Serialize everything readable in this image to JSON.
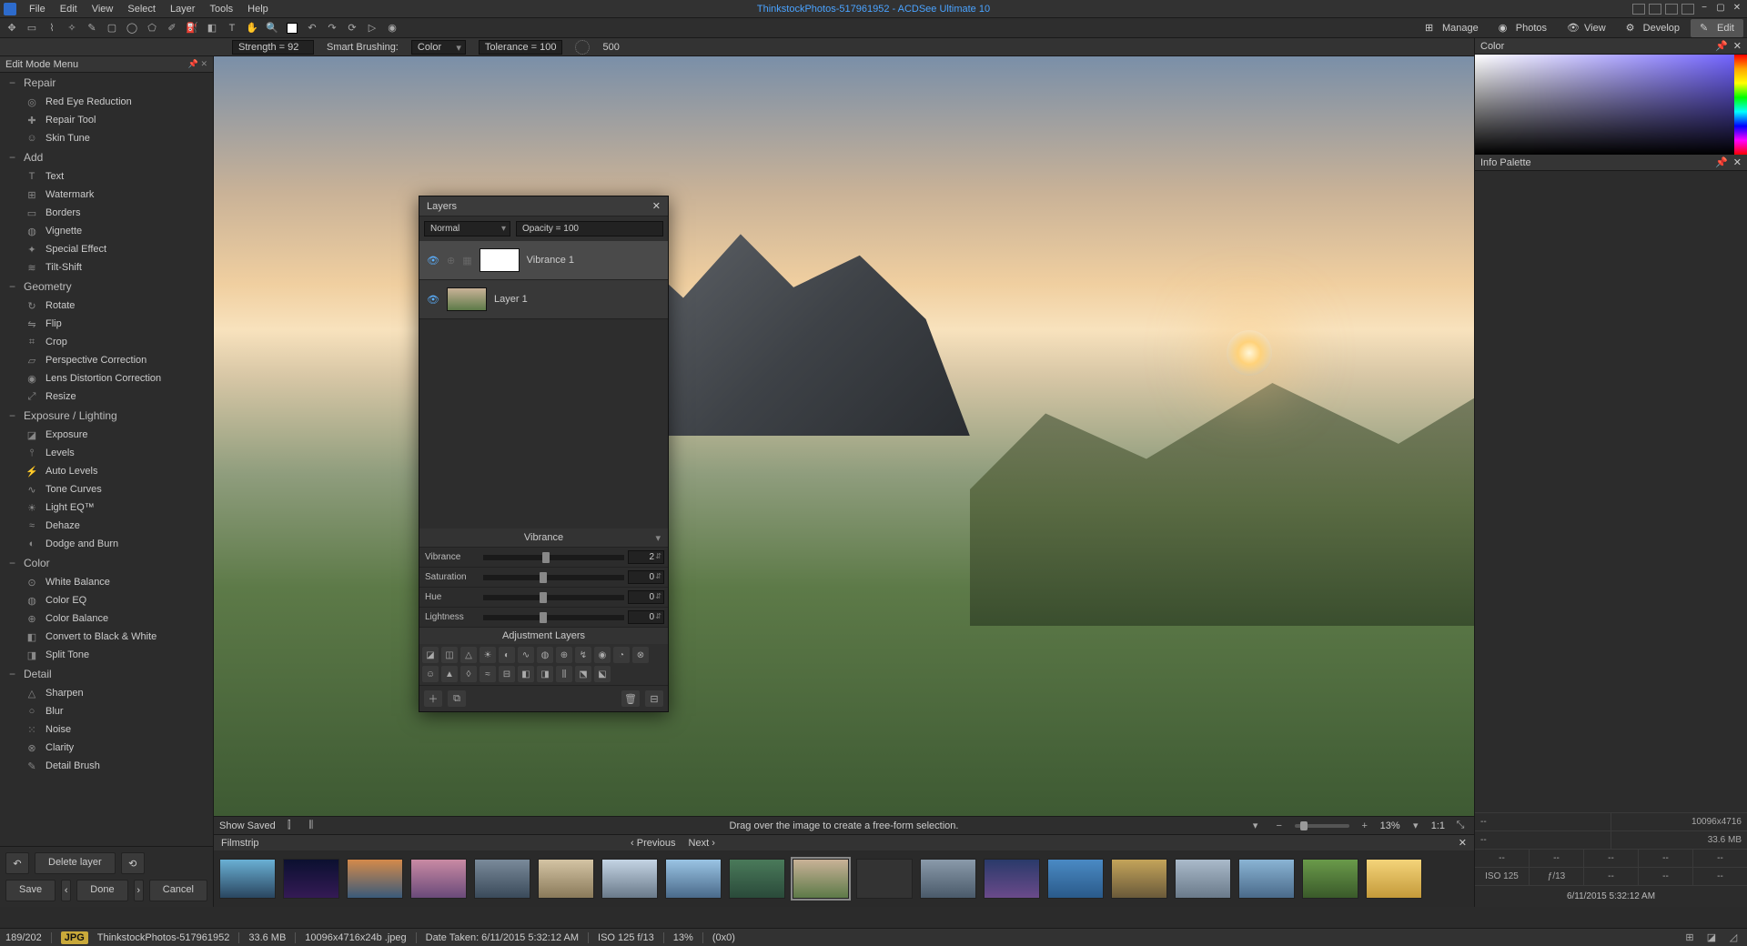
{
  "app": {
    "title": "ThinkstockPhotos-517961952 - ACDSee Ultimate 10"
  },
  "menu": [
    "File",
    "Edit",
    "View",
    "Select",
    "Layer",
    "Tools",
    "Help"
  ],
  "modes": [
    {
      "label": "Manage",
      "active": false
    },
    {
      "label": "Photos",
      "active": false
    },
    {
      "label": "View",
      "active": false
    },
    {
      "label": "Develop",
      "active": false
    },
    {
      "label": "Edit",
      "active": true
    }
  ],
  "toolbar2": {
    "strength": "Strength = 92",
    "smart_label": "Smart Brushing:",
    "smart_value": "Color",
    "tolerance": "Tolerance = 100",
    "brush_size": "500"
  },
  "left_panel": {
    "title": "Edit Mode Menu",
    "groups": [
      {
        "name": "Repair",
        "items": [
          {
            "label": "Red Eye Reduction",
            "icon": "◎",
            "dim": true
          },
          {
            "label": "Repair Tool",
            "icon": "✚"
          },
          {
            "label": "Skin Tune",
            "icon": "☺",
            "dim": true
          }
        ]
      },
      {
        "name": "Add",
        "items": [
          {
            "label": "Text",
            "icon": "T"
          },
          {
            "label": "Watermark",
            "icon": "⊞",
            "dim": true
          },
          {
            "label": "Borders",
            "icon": "▭"
          },
          {
            "label": "Vignette",
            "icon": "◍"
          },
          {
            "label": "Special Effect",
            "icon": "✦"
          },
          {
            "label": "Tilt-Shift",
            "icon": "≋"
          }
        ]
      },
      {
        "name": "Geometry",
        "items": [
          {
            "label": "Rotate",
            "icon": "↻"
          },
          {
            "label": "Flip",
            "icon": "⇋"
          },
          {
            "label": "Crop",
            "icon": "⌗"
          },
          {
            "label": "Perspective Correction",
            "icon": "▱"
          },
          {
            "label": "Lens Distortion Correction",
            "icon": "◉"
          },
          {
            "label": "Resize",
            "icon": "⤢"
          }
        ]
      },
      {
        "name": "Exposure / Lighting",
        "items": [
          {
            "label": "Exposure",
            "icon": "◪"
          },
          {
            "label": "Levels",
            "icon": "⫯"
          },
          {
            "label": "Auto Levels",
            "icon": "⚡"
          },
          {
            "label": "Tone Curves",
            "icon": "∿"
          },
          {
            "label": "Light EQ™",
            "icon": "☀"
          },
          {
            "label": "Dehaze",
            "icon": "≈"
          },
          {
            "label": "Dodge and Burn",
            "icon": "◐"
          }
        ]
      },
      {
        "name": "Color",
        "items": [
          {
            "label": "White Balance",
            "icon": "⊙",
            "dim": true
          },
          {
            "label": "Color EQ",
            "icon": "◍",
            "dim": true
          },
          {
            "label": "Color Balance",
            "icon": "⊕",
            "dim": true
          },
          {
            "label": "Convert to Black & White",
            "icon": "◧",
            "dim": true
          },
          {
            "label": "Split Tone",
            "icon": "◨",
            "dim": true
          }
        ]
      },
      {
        "name": "Detail",
        "items": [
          {
            "label": "Sharpen",
            "icon": "△"
          },
          {
            "label": "Blur",
            "icon": "○"
          },
          {
            "label": "Noise",
            "icon": "⁙"
          },
          {
            "label": "Clarity",
            "icon": "⊗"
          },
          {
            "label": "Detail Brush",
            "icon": "✎"
          }
        ]
      }
    ],
    "delete_layer": "Delete layer",
    "save": "Save",
    "done": "Done",
    "cancel": "Cancel"
  },
  "hint": {
    "show_saved": "Show Saved",
    "text": "Drag over the image to create a free-form selection.",
    "zoom": "13%",
    "ratio": "1:1"
  },
  "filmstrip": {
    "title": "Filmstrip",
    "prev": "Previous",
    "next": "Next",
    "count": 19,
    "selected": 9
  },
  "right": {
    "color_title": "Color",
    "info_title": "Info Palette",
    "dims": "10096x4716",
    "size": "33.6 MB",
    "row1": [
      "--",
      "--",
      "--",
      "--",
      "--"
    ],
    "row2": [
      "ISO 125",
      "ƒ/13",
      "--",
      "--",
      "--"
    ],
    "date": "6/11/2015 5:32:12 AM"
  },
  "layers": {
    "title": "Layers",
    "blend": "Normal",
    "opacity": "Opacity = 100",
    "items": [
      {
        "name": "Vibrance  1",
        "sel": true,
        "white": true
      },
      {
        "name": "Layer 1",
        "sel": false,
        "white": false
      }
    ],
    "vibrance_title": "Vibrance",
    "sliders": [
      {
        "label": "Vibrance",
        "val": "2",
        "pos": 42
      },
      {
        "label": "Saturation",
        "val": "0",
        "pos": 40
      },
      {
        "label": "Hue",
        "val": "0",
        "pos": 40
      },
      {
        "label": "Lightness",
        "val": "0",
        "pos": 40
      }
    ],
    "adj_title": "Adjustment Layers"
  },
  "status": {
    "counter": "189/202",
    "badge": "JPG",
    "filename": "ThinkstockPhotos-517961952",
    "size": "33.6 MB",
    "dims": "10096x4716x24b .jpeg",
    "date": "Date Taken: 6/11/2015 5:32:12 AM",
    "iso": "ISO 125   f/13",
    "zoom": "13%",
    "coords": "(0x0)"
  }
}
